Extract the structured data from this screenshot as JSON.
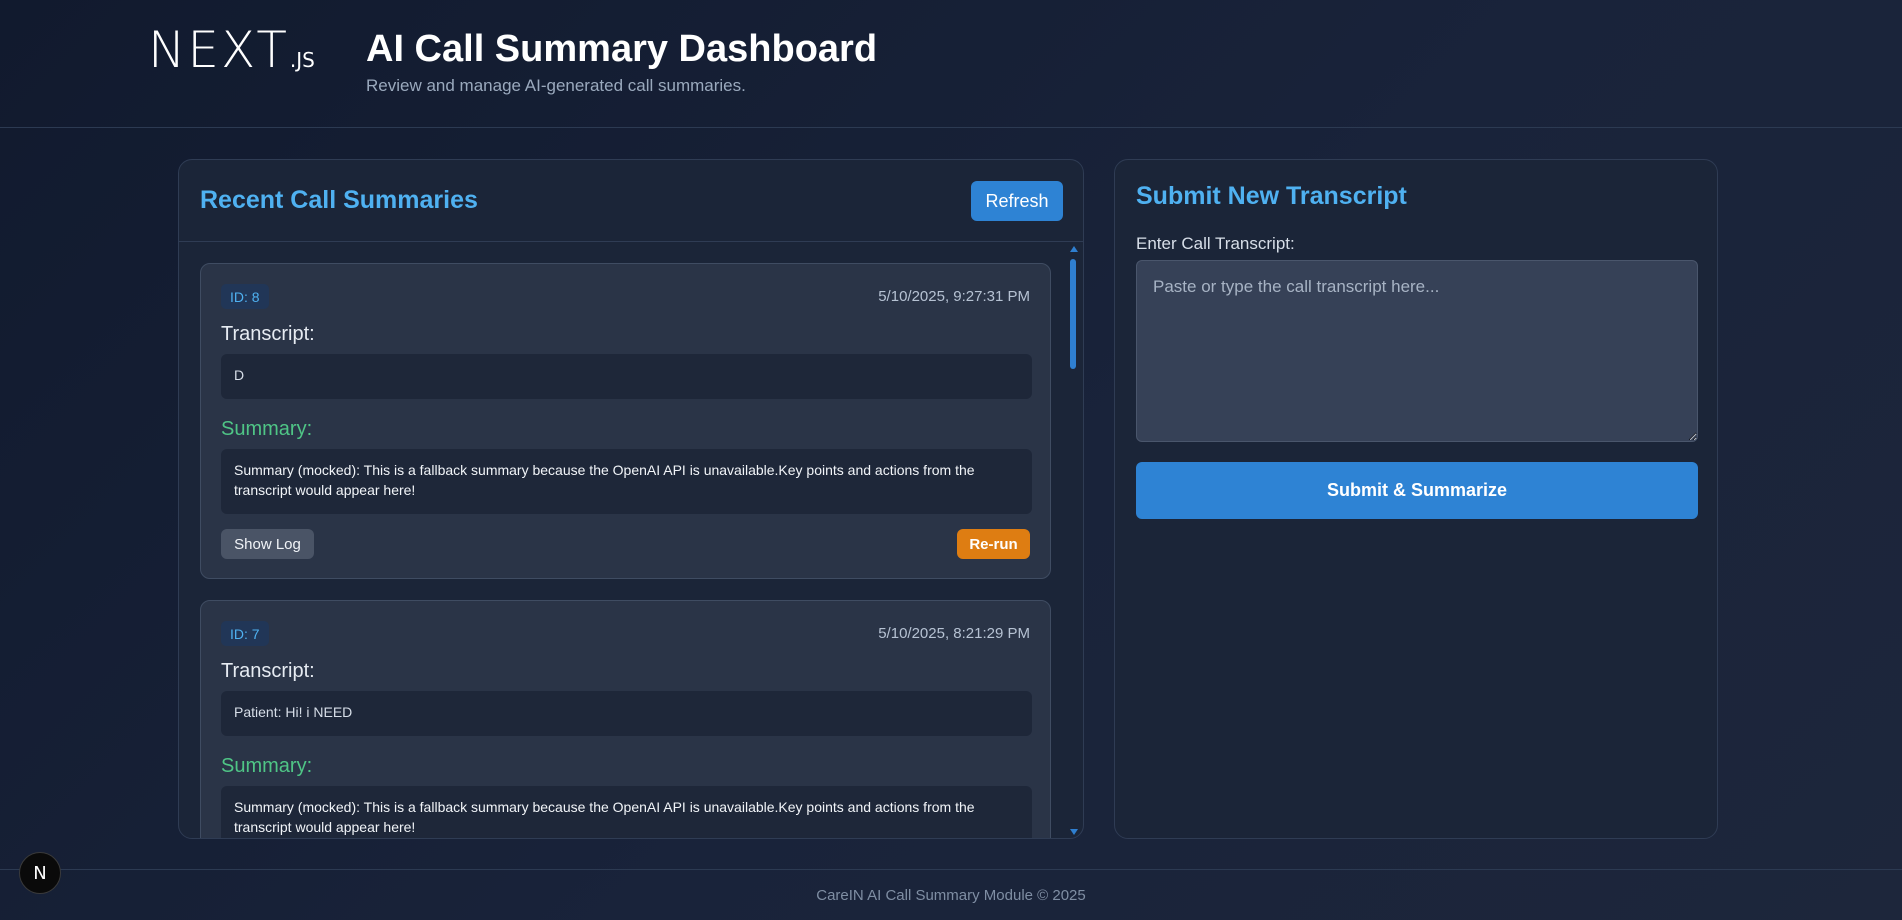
{
  "header": {
    "logo_text": "NEXT",
    "logo_suffix": ".JS",
    "title": "AI Call Summary Dashboard",
    "subtitle": "Review and manage AI-generated call summaries."
  },
  "summaries_panel": {
    "title": "Recent Call Summaries",
    "refresh_label": "Refresh",
    "items": [
      {
        "id_label": "ID: 8",
        "date": "5/10/2025, 9:27:31 PM",
        "transcript_label": "Transcript:",
        "transcript": "D",
        "summary_label": "Summary:",
        "summary": "Summary (mocked): This is a fallback summary because the OpenAI API is unavailable.Key points and actions from the transcript would appear here!",
        "show_log_label": "Show Log",
        "rerun_label": "Re-run"
      },
      {
        "id_label": "ID: 7",
        "date": "5/10/2025, 8:21:29 PM",
        "transcript_label": "Transcript:",
        "transcript": "Patient: Hi! i NEED",
        "summary_label": "Summary:",
        "summary": "Summary (mocked): This is a fallback summary because the OpenAI API is unavailable.Key points and actions from the transcript would appear here!"
      }
    ]
  },
  "submit_panel": {
    "title": "Submit New Transcript",
    "input_label": "Enter Call Transcript:",
    "input_placeholder": "Paste or type the call transcript here...",
    "input_value": "",
    "submit_label": "Submit & Summarize"
  },
  "footer": {
    "text": "CareIN AI Call Summary Module © 2025"
  },
  "dev_badge": {
    "label": "N"
  },
  "colors": {
    "accent": "#4fb1f1",
    "primary_button": "#2e83d4",
    "summary_label": "#4fc586",
    "rerun_button": "#de7d12"
  }
}
